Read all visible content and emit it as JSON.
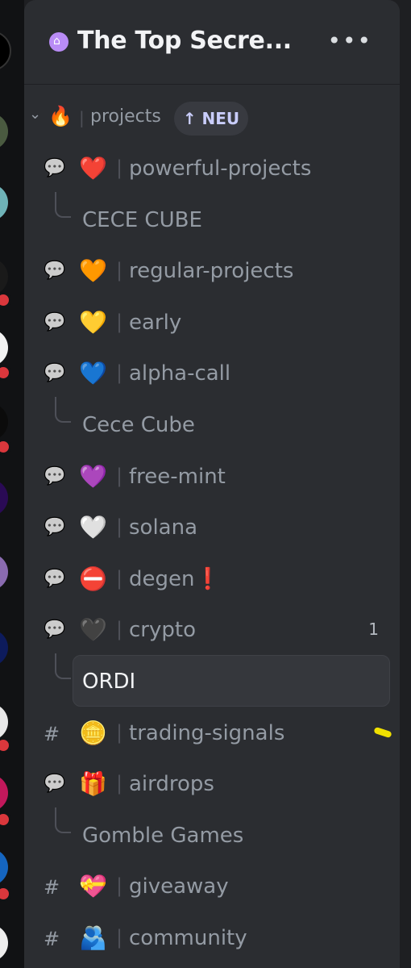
{
  "server": {
    "name": "The Top Secre...",
    "badge_icon": "home-icon"
  },
  "more_icon": "•••",
  "category": {
    "emoji": "🔥",
    "name": "projects",
    "badge": "↑ NEU"
  },
  "channels": [
    {
      "icon": "forum-icon",
      "emoji": "❤️",
      "name": "powerful-projects",
      "thread": "CECE CUBE"
    },
    {
      "icon": "forum-icon",
      "emoji": "🧡",
      "name": "regular-projects"
    },
    {
      "icon": "forum-icon",
      "emoji": "💛",
      "name": "early"
    },
    {
      "icon": "forum-icon",
      "emoji": "💙",
      "name": "alpha-call",
      "thread": "Cece Cube"
    },
    {
      "icon": "forum-icon",
      "emoji": "💜",
      "name": "free-mint"
    },
    {
      "icon": "forum-icon",
      "emoji": "🤍",
      "name": "solana"
    },
    {
      "icon": "forum-icon",
      "emoji": "⛔",
      "name": "degen",
      "suffix": "❗"
    },
    {
      "icon": "forum-icon",
      "emoji": "🖤",
      "name": "crypto",
      "count": "1",
      "thread": "ORDI"
    },
    {
      "icon": "hash-icon",
      "emoji": "🪙",
      "name": "trading-signals"
    },
    {
      "icon": "forum-icon",
      "emoji": "🎁",
      "name": "airdrops",
      "thread": "Gomble Games"
    },
    {
      "icon": "hash-icon",
      "emoji": "💝",
      "name": "giveaway"
    },
    {
      "icon": "hash-icon",
      "emoji": "🫂",
      "name": "community"
    }
  ],
  "colors": {
    "background": "#2b2d31",
    "rail": "#111214",
    "accent": "#c9cdfb",
    "unread_mark": "#f0e000"
  }
}
